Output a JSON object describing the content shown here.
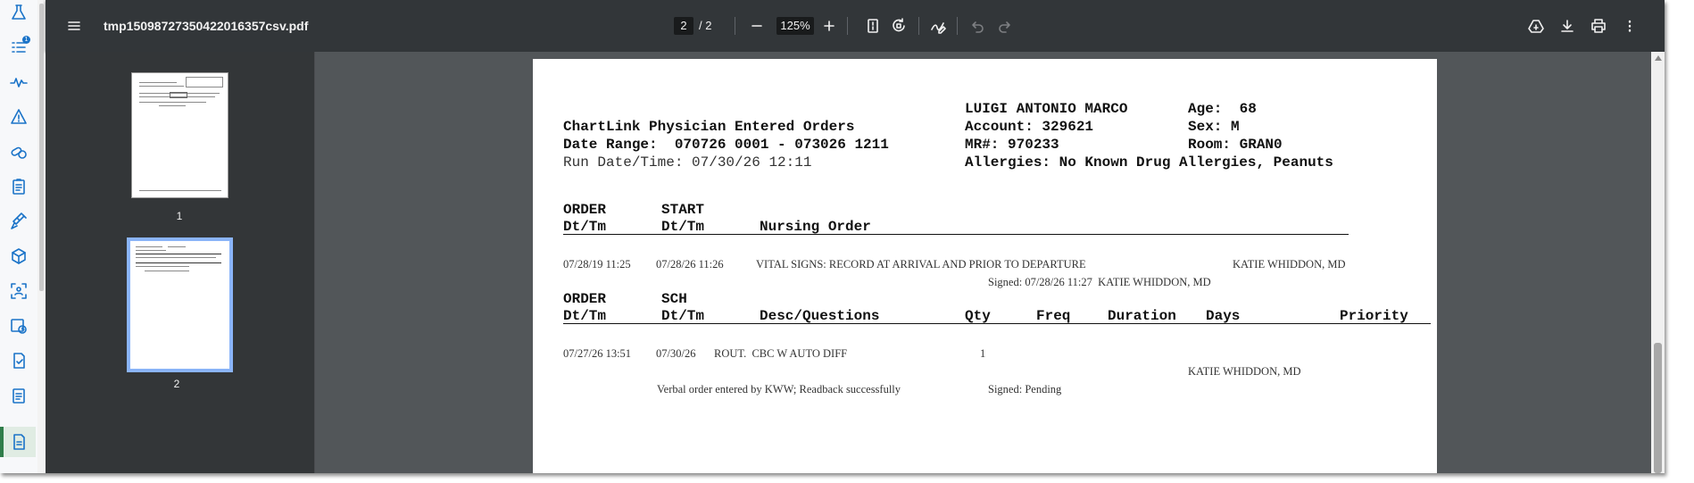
{
  "viewer": {
    "filename": "tmp15098727350422016357csv.pdf",
    "current_page": "2",
    "page_total": "/ 2",
    "zoom": "125%"
  },
  "icons": {
    "rail": [
      "flask-icon",
      "task-list-icon",
      "vitals-icon",
      "warning-icon",
      "pills-icon",
      "clipboard-icon",
      "injection-icon",
      "box-icon",
      "scan-icon",
      "schedule-icon",
      "document-check-icon",
      "notes-icon",
      "pdf-document-icon"
    ],
    "rail_badge": "1"
  },
  "thumbnails": [
    {
      "label": "1"
    },
    {
      "label": "2"
    }
  ],
  "doc": {
    "title": "ChartLink Physician Entered Orders",
    "date_range": "Date Range:  070726 0001 - 073026 1211",
    "run_date": "Run Date/Time: 07/30/26 12:11",
    "patient": {
      "name": "LUIGI ANTONIO MARCO",
      "account": "Account: 329621",
      "mr": "MR#: 970233",
      "allergies": "Allergies: No Known Drug Allergies, Peanuts",
      "age": "Age:  68",
      "sex": "Sex: M",
      "room": "Room: GRAN0"
    },
    "section1": {
      "headers": {
        "order": "ORDER",
        "start": "START",
        "order_dt": "Dt/Tm",
        "start_dt": "Dt/Tm",
        "nursing_order": "Nursing Order"
      },
      "row": {
        "order_dt": "07/28/19 11:25",
        "start_dt": "07/28/26 11:26",
        "text": "VITAL SIGNS: RECORD AT ARRIVAL AND PRIOR TO DEPARTURE",
        "provider": "KATIE WHIDDON, MD",
        "signed": "Signed: 07/28/26 11:27  KATIE WHIDDON, MD"
      }
    },
    "section2": {
      "headers": {
        "order": "ORDER",
        "sch": "SCH",
        "order_dt": "Dt/Tm",
        "sch_dt": "Dt/Tm",
        "desc": "Desc/Questions",
        "qty": "Qty",
        "freq": "Freq",
        "duration": "Duration",
        "days": "Days",
        "priority": "Priority"
      },
      "row": {
        "order_dt": "07/27/26 13:51",
        "sch_dt": "07/30/26",
        "desc": "ROUT.  CBC W AUTO DIFF",
        "qty": "1",
        "provider": "KATIE WHIDDON, MD",
        "verbal": "Verbal order entered by KWW; Readback successfully",
        "signed": "Signed: Pending"
      }
    }
  }
}
